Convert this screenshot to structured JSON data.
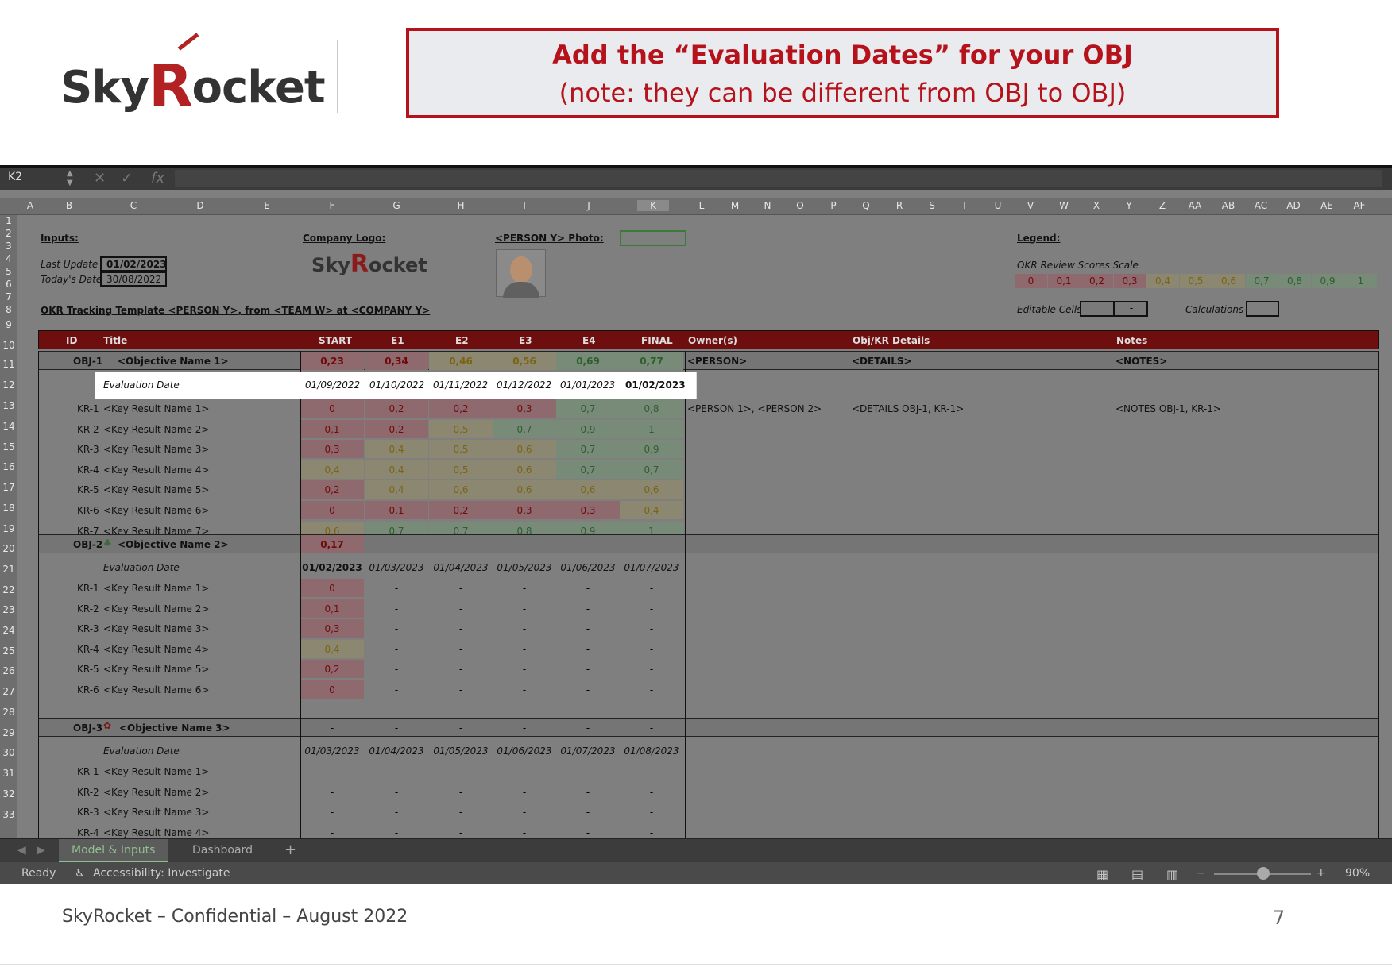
{
  "callout": {
    "line1": "Add the “Evaluation Dates” for your OBJ",
    "line2": "(note: they can be different from OBJ to OBJ)"
  },
  "logo": {
    "text_prefix": "Sky",
    "text_r": "R",
    "text_suffix": "ocket"
  },
  "formula_bar": {
    "name_box": "K2",
    "fx": "fx"
  },
  "columns": [
    "A",
    "B",
    "C",
    "D",
    "E",
    "F",
    "G",
    "H",
    "I",
    "J",
    "K",
    "L",
    "M",
    "N",
    "O",
    "P",
    "Q",
    "R",
    "S",
    "T",
    "U",
    "V",
    "W",
    "X",
    "Y",
    "Z",
    "AA",
    "AB",
    "AC",
    "AD",
    "AE",
    "AF"
  ],
  "rows": [
    "1",
    "2",
    "3",
    "4",
    "5",
    "6",
    "7",
    "8",
    "9",
    "10",
    "11",
    "12",
    "13",
    "14",
    "15",
    "16",
    "17",
    "18",
    "19",
    "20",
    "21",
    "22",
    "23",
    "24",
    "25",
    "26",
    "27",
    "28",
    "29",
    "30",
    "31",
    "32",
    "33"
  ],
  "inputs": {
    "label": "Inputs:",
    "last_update_label": "Last Update",
    "last_update": "01/02/2023",
    "today_label": "Today's Date",
    "today": "30/08/2022",
    "company_logo_label": "Company Logo:",
    "photo_label": "<PERSON Y> Photo:",
    "template_title": "OKR Tracking Template <PERSON Y>, from <TEAM W> at <COMPANY Y>"
  },
  "legend": {
    "label": "Legend:",
    "scale_label": "OKR Review Scores Scale",
    "scale": [
      "0",
      "0,1",
      "0,2",
      "0,3",
      "0,4",
      "0,5",
      "0,6",
      "0,7",
      "0,8",
      "0,9",
      "1"
    ],
    "editable_label": "Editable Cells",
    "editable_sample": "-",
    "calc_label": "Calculations"
  },
  "header": {
    "id": "ID",
    "title": "Title",
    "start": "START",
    "e1": "E1",
    "e2": "E2",
    "e3": "E3",
    "e4": "E4",
    "final": "FINAL",
    "owners": "Owner(s)",
    "details": "Obj/KR Details",
    "notes": "Notes"
  },
  "obj1": {
    "id": "OBJ-1",
    "name": "<Objective Name 1>",
    "scores": [
      "0,23",
      "0,34",
      "0,46",
      "0,56",
      "0,69",
      "0,77"
    ],
    "owner": "<PERSON>",
    "details": "<DETAILS>",
    "notes": "<NOTES>",
    "eval_label": "Evaluation Date",
    "dates": [
      "01/09/2022",
      "01/10/2022",
      "01/11/2022",
      "01/12/2022",
      "01/01/2023",
      "01/02/2023"
    ],
    "krs": [
      {
        "id": "KR-1",
        "name": "<Key Result Name 1>",
        "v": [
          "0",
          "0,2",
          "0,2",
          "0,3",
          "0,7",
          "0,8"
        ],
        "owner": "<PERSON 1>, <PERSON 2>",
        "details": "<DETAILS OBJ-1, KR-1>",
        "notes": "<NOTES OBJ-1, KR-1>"
      },
      {
        "id": "KR-2",
        "name": "<Key Result Name 2>",
        "v": [
          "0,1",
          "0,2",
          "0,5",
          "0,7",
          "0,9",
          "1"
        ]
      },
      {
        "id": "KR-3",
        "name": "<Key Result Name 3>",
        "v": [
          "0,3",
          "0,4",
          "0,5",
          "0,6",
          "0,7",
          "0,9"
        ]
      },
      {
        "id": "KR-4",
        "name": "<Key Result Name 4>",
        "v": [
          "0,4",
          "0,4",
          "0,5",
          "0,6",
          "0,7",
          "0,7"
        ]
      },
      {
        "id": "KR-5",
        "name": "<Key Result Name 5>",
        "v": [
          "0,2",
          "0,4",
          "0,6",
          "0,6",
          "0,6",
          "0,6"
        ]
      },
      {
        "id": "KR-6",
        "name": "<Key Result Name 6>",
        "v": [
          "0",
          "0,1",
          "0,2",
          "0,3",
          "0,3",
          "0,4"
        ]
      },
      {
        "id": "KR-7",
        "name": "<Key Result Name 7>",
        "v": [
          "0,6",
          "0,7",
          "0,7",
          "0,8",
          "0,9",
          "1"
        ]
      }
    ]
  },
  "obj2": {
    "id": "OBJ-2",
    "name": "<Objective Name 2>",
    "start": "0,17",
    "dash": "-",
    "eval_label": "Evaluation Date",
    "dates": [
      "01/02/2023",
      "01/03/2023",
      "01/04/2023",
      "01/05/2023",
      "01/06/2023",
      "01/07/2023"
    ],
    "krs": [
      {
        "id": "KR-1",
        "name": "<Key Result Name 1>",
        "v": "0"
      },
      {
        "id": "KR-2",
        "name": "<Key Result Name 2>",
        "v": "0,1"
      },
      {
        "id": "KR-3",
        "name": "<Key Result Name 3>",
        "v": "0,3"
      },
      {
        "id": "KR-4",
        "name": "<Key Result Name 4>",
        "v": "0,4"
      },
      {
        "id": "KR-5",
        "name": "<Key Result Name 5>",
        "v": "0,2"
      },
      {
        "id": "KR-6",
        "name": "<Key Result Name 6>",
        "v": "0"
      }
    ],
    "empty_row": "- -"
  },
  "obj3": {
    "id": "OBJ-3",
    "name": "<Objective Name 3>",
    "eval_label": "Evaluation Date",
    "dates": [
      "01/03/2023",
      "01/04/2023",
      "01/05/2023",
      "01/06/2023",
      "01/07/2023",
      "01/08/2023"
    ],
    "krs": [
      {
        "id": "KR-1",
        "name": "<Key Result Name 1>"
      },
      {
        "id": "KR-2",
        "name": "<Key Result Name 2>"
      },
      {
        "id": "KR-3",
        "name": "<Key Result Name 3>"
      },
      {
        "id": "KR-4",
        "name": "<Key Result Name 4>"
      }
    ]
  },
  "tabs": {
    "model": "Model & Inputs",
    "dashboard": "Dashboard",
    "add": "+"
  },
  "status": {
    "ready": "Ready",
    "accessibility": "Accessibility: Investigate",
    "zoom": "90%",
    "minus": "−",
    "plus": "+"
  },
  "footer": {
    "text": "SkyRocket – Confidential – August 2022",
    "page": "7"
  }
}
